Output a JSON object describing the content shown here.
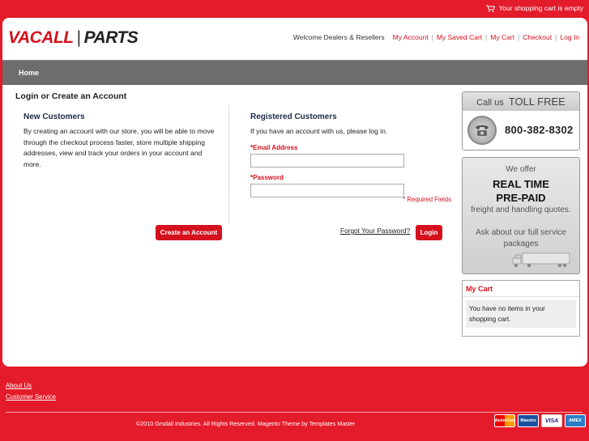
{
  "topbar": {
    "cart_status": "Your shopping cart is empty"
  },
  "header": {
    "logo_part1": "VACALL",
    "logo_sep": "|",
    "logo_part2": "PARTS",
    "welcome": "Welcome Dealers & Resellers",
    "links": [
      "My Account",
      "My Saved Cart",
      "My Cart",
      "Checkout",
      "Log In"
    ]
  },
  "nav": {
    "home": "Home"
  },
  "main": {
    "title": "Login or Create an Account",
    "new_customers": {
      "heading": "New Customers",
      "text": "By creating an account with our store, you will be able to move through the checkout process faster, store multiple shipping addresses, view and track your orders in your account and more.",
      "button": "Create an Account"
    },
    "registered": {
      "heading": "Registered Customers",
      "text": "If you have an account with us, please log in.",
      "email_label": "*Email Address",
      "email_value": "",
      "password_label": "*Password",
      "password_value": "",
      "required": "* Required Fields",
      "forgot": "Forgot Your Password?",
      "login_button": "Login"
    }
  },
  "sidebar": {
    "tollfree": {
      "call_us": "Call us",
      "toll_free": "TOLL FREE",
      "number": "800-382-8302"
    },
    "freight": {
      "line1": "We offer",
      "line2": "REAL TIME",
      "line3": "PRE-PAID",
      "line4": "freight and handling quotes.",
      "line5": "Ask about our full service packages"
    },
    "mycart": {
      "heading": "My Cart",
      "text": "You have no items in your shopping cart."
    }
  },
  "footer": {
    "links": [
      "About Us",
      "Customer Service"
    ],
    "copyright": "©2010 Grsdall Industries. All Rights Reserved. Magento Theme by Templates Master",
    "cards": [
      "MasterCard",
      "Maestro",
      "VISA",
      "AMEX"
    ]
  },
  "colors": {
    "brand_red": "#e31b2a",
    "nav_gray": "#6d6d6d",
    "link_red": "#d4111d"
  }
}
